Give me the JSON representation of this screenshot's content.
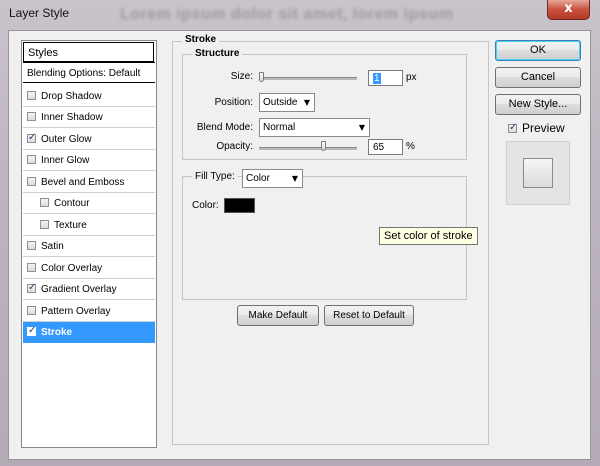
{
  "window": {
    "title": "Layer Style",
    "background_text": "Lorem ipsum dolor sit amet, lorem ipsum",
    "close_glyph": "x"
  },
  "styles_panel": {
    "header": "Styles",
    "items": [
      {
        "label": "Blending Options: Default"
      },
      {
        "label": "Drop Shadow",
        "checked": false
      },
      {
        "label": "Inner Shadow",
        "checked": false
      },
      {
        "label": "Outer Glow",
        "checked": true
      },
      {
        "label": "Inner Glow",
        "checked": false
      },
      {
        "label": "Bevel and Emboss",
        "checked": false
      },
      {
        "label": "Contour",
        "checked": false
      },
      {
        "label": "Texture",
        "checked": false
      },
      {
        "label": "Satin",
        "checked": false
      },
      {
        "label": "Color Overlay",
        "checked": false
      },
      {
        "label": "Gradient Overlay",
        "checked": true
      },
      {
        "label": "Pattern Overlay",
        "checked": false
      },
      {
        "label": "Stroke",
        "checked": true,
        "selected": true
      }
    ]
  },
  "stroke": {
    "section_title": "Stroke",
    "structure_title": "Structure",
    "size": {
      "label": "Size:",
      "value": "1",
      "unit": "px"
    },
    "position": {
      "label": "Position:",
      "value": "Outside"
    },
    "blend_mode": {
      "label": "Blend Mode:",
      "value": "Normal"
    },
    "opacity": {
      "label": "Opacity:",
      "value": "65",
      "unit": "%"
    },
    "fill_type": {
      "label": "Fill Type:",
      "value": "Color"
    },
    "color": {
      "label": "Color:",
      "value": "#000000"
    },
    "tooltip": "Set color of stroke",
    "make_default": "Make Default",
    "reset_default": "Reset to Default"
  },
  "buttons": {
    "ok": "OK",
    "cancel": "Cancel",
    "new_style": "New Style...",
    "preview_label": "Preview",
    "preview_checked": true
  },
  "colors": {
    "selection": "#3399ff",
    "tooltip_bg": "#ffffe1",
    "close_button": "#c9503d"
  }
}
